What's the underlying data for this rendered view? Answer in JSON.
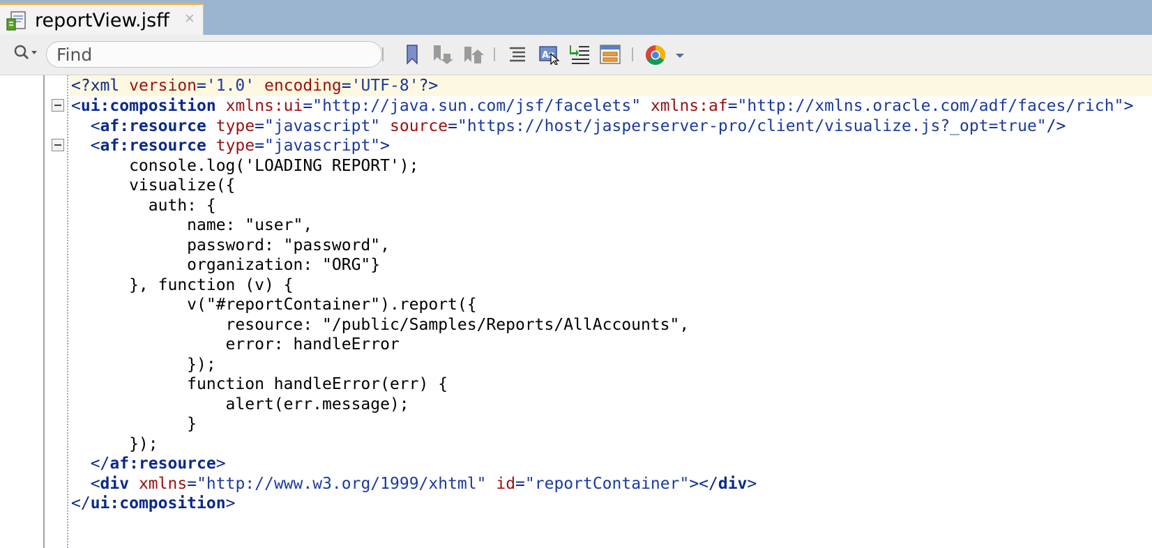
{
  "tab": {
    "title": "reportView.jsff",
    "close": "×",
    "icon": "jsff-file-icon"
  },
  "toolbar": {
    "find_placeholder": "Find",
    "buttons": [
      "toggle-bookmark",
      "previous-bookmark",
      "next-bookmark",
      "outline",
      "find-usages",
      "reformat",
      "properties",
      "run-in-chrome",
      "dropdown"
    ]
  },
  "code": {
    "l1": {
      "a": "<?xml ",
      "b": "version",
      "c": "=",
      "d": "'1.0'",
      "e": " ",
      "f": "encoding",
      "g": "=",
      "h": "'UTF-8'",
      "i": "?>"
    },
    "l2": {
      "a": "<",
      "b": "ui:composition",
      "c": " ",
      "d": "xmlns:ui",
      "e": "=",
      "f": "\"http://java.sun.com/jsf/facelets\"",
      "g": " ",
      "h": "xmlns:af",
      "i": "=",
      "j": "\"http://xmlns.oracle.com/adf/faces/rich\"",
      "k": ">"
    },
    "l3": {
      "a": "  <",
      "b": "af:resource",
      "c": " ",
      "d": "type",
      "e": "=",
      "f": "\"javascript\"",
      "g": " ",
      "h": "source",
      "i": "=",
      "j": "\"https://host/jasperserver-pro/client/visualize.js?_opt=true\"",
      "k": "/>"
    },
    "l4": {
      "a": "  <",
      "b": "af:resource",
      "c": " ",
      "d": "type",
      "e": "=",
      "f": "\"javascript\"",
      "g": ">"
    },
    "l5": "      console.log('LOADING REPORT');",
    "l6": "      visualize({",
    "l7": "        auth: {",
    "l8": "            name: \"user\",",
    "l9": "            password: \"password\",",
    "l10": "            organization: \"ORG\"}",
    "l11": "      }, function (v) {",
    "l12": "            v(\"#reportContainer\").report({",
    "l13": "                resource: \"/public/Samples/Reports/AllAccounts\",",
    "l14": "                error: handleError",
    "l15": "            });",
    "l16": "            function handleError(err) {",
    "l17": "                alert(err.message);",
    "l18": "            }",
    "l19": "      });",
    "l20": {
      "a": "  </",
      "b": "af:resource",
      "c": ">"
    },
    "l21": {
      "a": "  <",
      "b": "div",
      "c": " ",
      "d": "xmlns",
      "e": "=",
      "f": "\"http://www.w3.org/1999/xhtml\"",
      "g": " ",
      "h": "id",
      "i": "=",
      "j": "\"reportContainer\"",
      "k": "></",
      "l": "div",
      "m": ">"
    },
    "l22": {
      "a": "</",
      "b": "ui:composition",
      "c": ">"
    }
  }
}
